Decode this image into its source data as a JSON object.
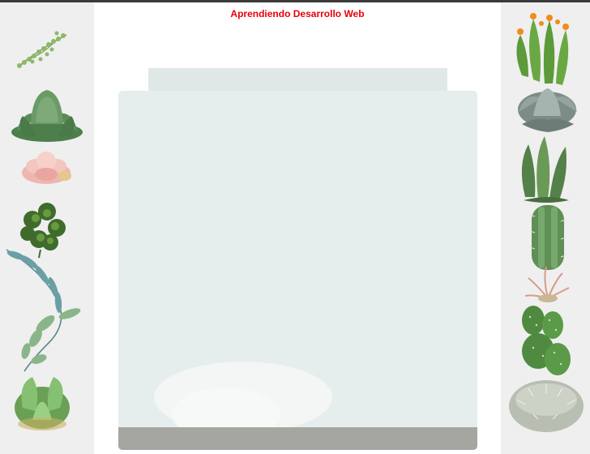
{
  "header": {
    "title": "Aprendiendo Desarrollo Web"
  },
  "left_decor": {
    "plants": [
      "string-of-pearls-icon",
      "echeveria-icon",
      "pink-succulent-icon",
      "clover-succulent-icon",
      "eucalyptus-branch-icon",
      "jade-succulent-icon"
    ]
  },
  "right_decor": {
    "plants": [
      "flowering-cactus-icon",
      "silver-echeveria-icon",
      "aloe-icon",
      "columnar-cactus-icon",
      "air-plant-icon",
      "prickly-pear-icon",
      "round-cactus-icon"
    ]
  },
  "colors": {
    "title": "#e8000b",
    "side_background": "#efefef",
    "panel": "#e6eeed",
    "panel_footer": "#a6a6a1"
  }
}
